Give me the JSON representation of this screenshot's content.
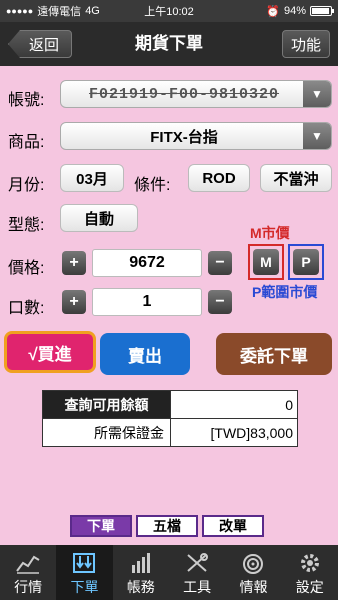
{
  "status": {
    "carrier": "遠傳電信",
    "network": "4G",
    "time": "上午10:02",
    "battery": "94%",
    "battery_level": 0.94
  },
  "nav": {
    "back": "返回",
    "title": "期貨下單",
    "function": "功能"
  },
  "form": {
    "account_label": "帳號:",
    "account_value": "F021919-F00-9810320",
    "product_label": "商品:",
    "product_value": "FITX-台指",
    "month_label": "月份:",
    "month_value": "03月",
    "condition_label": "條件:",
    "condition_value": "ROD",
    "offset_value": "不當沖",
    "type_label": "型態:",
    "type_value": "自動",
    "price_label": "價格:",
    "price_value": "9672",
    "qty_label": "口數:",
    "qty_value": "1",
    "plus": "+",
    "minus": "−"
  },
  "market": {
    "m_label": "M市價",
    "m_btn": "M",
    "p_btn": "P",
    "p_label": "P範圍市價",
    "m_color": "#d42a2a",
    "p_color": "#2a4ad4"
  },
  "actions": {
    "buy": "√買進",
    "sell": "賣出",
    "submit": "委託下單",
    "buy_color": "#e0246e",
    "sell_color": "#1a6fd0",
    "submit_color": "#8a4a2a"
  },
  "info": {
    "query_label": "查詢可用餘額",
    "query_value": "0",
    "margin_label": "所需保證金",
    "margin_value": "[TWD]83,000"
  },
  "subtabs": [
    "下單",
    "五檔",
    "改單"
  ],
  "tabs": [
    {
      "label": "行情",
      "icon": "chart-icon"
    },
    {
      "label": "下單",
      "icon": "order-icon"
    },
    {
      "label": "帳務",
      "icon": "ledger-icon"
    },
    {
      "label": "工具",
      "icon": "tools-icon"
    },
    {
      "label": "情報",
      "icon": "news-icon"
    },
    {
      "label": "設定",
      "icon": "gear-icon"
    }
  ]
}
